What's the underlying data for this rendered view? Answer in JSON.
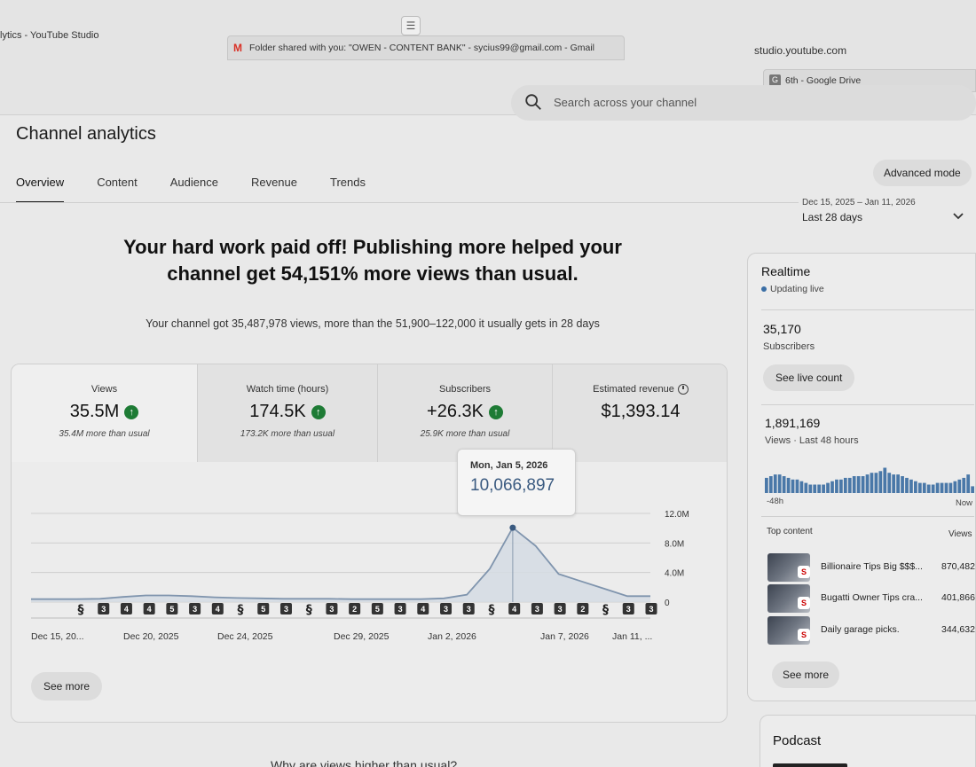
{
  "browser": {
    "tab_title": "lytics - YouTube Studio",
    "url": "studio.youtube.com",
    "gmail_tab": "Folder shared with you: \"OWEN - CONTENT BANK\" - sycius99@gmail.com - Gmail",
    "drive_tab": "6th - Google Drive"
  },
  "search": {
    "placeholder": "Search across your channel"
  },
  "page": {
    "title": "Channel analytics",
    "tabs": [
      "Overview",
      "Content",
      "Audience",
      "Revenue",
      "Trends"
    ],
    "active_tab": "Overview",
    "advanced_mode": "Advanced mode",
    "date_range": "Dec 15, 2025 – Jan 11, 2026",
    "range_label": "Last 28 days"
  },
  "headline": {
    "line1": "Your hard work paid off! Publishing more helped your",
    "line2": "channel get 54,151% more views than usual.",
    "sub": "Your channel got 35,487,978 views, more than the 51,900–122,000 it usually gets in 28 days"
  },
  "metrics": [
    {
      "label": "Views",
      "value": "35.5M",
      "sub": "35.4M more than usual",
      "trend": "up"
    },
    {
      "label": "Watch time (hours)",
      "value": "174.5K",
      "sub": "173.2K more than usual",
      "trend": "up"
    },
    {
      "label": "Subscribers",
      "value": "+26.3K",
      "sub": "25.9K more than usual",
      "trend": "up"
    },
    {
      "label": "Estimated revenue",
      "value": "$1,393.14",
      "sub": "",
      "trend": "none"
    }
  ],
  "tooltip": {
    "date": "Mon, Jan 5, 2026",
    "value": "10,066,897"
  },
  "chart_data": {
    "type": "area",
    "y_ticks": [
      "12.0M",
      "8.0M",
      "4.0M",
      "0"
    ],
    "ylim": [
      0,
      12000000
    ],
    "x_tick_labels": [
      "Dec 15, 20...",
      "Dec 20, 2025",
      "Dec 24, 2025",
      "Dec 29, 2025",
      "Jan 2, 2026",
      "Jan 7, 2026",
      "Jan 11, ..."
    ],
    "x": [
      "Dec 15",
      "Dec 16",
      "Dec 17",
      "Dec 18",
      "Dec 19",
      "Dec 20",
      "Dec 21",
      "Dec 22",
      "Dec 23",
      "Dec 24",
      "Dec 25",
      "Dec 26",
      "Dec 27",
      "Dec 28",
      "Dec 29",
      "Dec 30",
      "Dec 31",
      "Jan 1",
      "Jan 2",
      "Jan 3",
      "Jan 4",
      "Jan 5",
      "Jan 6",
      "Jan 7",
      "Jan 8",
      "Jan 9",
      "Jan 10",
      "Jan 11"
    ],
    "values": [
      400000,
      400000,
      400000,
      450000,
      700000,
      900000,
      900000,
      800000,
      650000,
      550000,
      500000,
      450000,
      450000,
      450000,
      400000,
      400000,
      400000,
      400000,
      500000,
      1000000,
      4500000,
      10066897,
      7600000,
      3800000,
      2800000,
      1800000,
      800000,
      800000
    ],
    "upload_markers": [
      "shorts",
      "3",
      "4",
      "4",
      "5",
      "3",
      "4",
      "shorts",
      "5",
      "3",
      "shorts",
      "3",
      "2",
      "5",
      "3",
      "4",
      "3",
      "3",
      "shorts",
      "4",
      "3",
      "3",
      "2",
      "shorts",
      "3",
      "3"
    ],
    "highlight_index": 21
  },
  "card_see_more": "See more",
  "realtime": {
    "title": "Realtime",
    "status": "Updating live",
    "subscribers_value": "35,170",
    "subscribers_label": "Subscribers",
    "live_count_btn": "See live count",
    "views_value": "1,891,169",
    "views_label": "Views · Last 48 hours",
    "axis_start": "-48h",
    "axis_end": "Now",
    "hourly_bars": [
      0.45,
      0.5,
      0.55,
      0.55,
      0.5,
      0.45,
      0.4,
      0.4,
      0.35,
      0.3,
      0.25,
      0.25,
      0.25,
      0.25,
      0.3,
      0.35,
      0.4,
      0.4,
      0.45,
      0.45,
      0.5,
      0.5,
      0.5,
      0.55,
      0.6,
      0.6,
      0.65,
      0.75,
      0.6,
      0.55,
      0.55,
      0.5,
      0.45,
      0.4,
      0.35,
      0.3,
      0.3,
      0.25,
      0.25,
      0.3,
      0.3,
      0.3,
      0.3,
      0.35,
      0.4,
      0.45,
      0.55,
      0.2
    ],
    "top_content_label": "Top content",
    "views_col_label": "Views",
    "top_content": [
      {
        "title": "Billionaire Tips Big $$$...",
        "views": "870,482"
      },
      {
        "title": "Bugatti Owner Tips cra...",
        "views": "401,866"
      },
      {
        "title": "Daily garage picks.",
        "views": "344,632"
      }
    ],
    "see_more": "See more"
  },
  "podcast": {
    "title": "Podcast"
  },
  "bottom_question": "Why are views higher than usual?",
  "colors": {
    "accent": "#3a5a80",
    "positive": "#1e7b35",
    "chart_line": "#7f94ad",
    "chart_fill": "#d3dbe4"
  }
}
